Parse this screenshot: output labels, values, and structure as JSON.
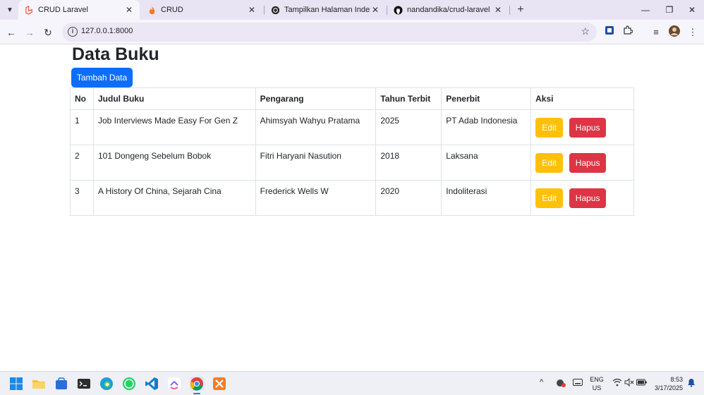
{
  "tabs": [
    {
      "title": "CRUD Laravel",
      "active": true
    },
    {
      "title": "CRUD",
      "active": false
    },
    {
      "title": "Tampilkan Halaman Index Buku",
      "active": false
    },
    {
      "title": "nandandika/crud-laravel",
      "active": false
    }
  ],
  "address_bar": {
    "url": "127.0.0.1:8000"
  },
  "page": {
    "title": "Data Buku",
    "add_button": "Tambah Data",
    "columns": [
      "No",
      "Judul Buku",
      "Pengarang",
      "Tahun Terbit",
      "Penerbit",
      "Aksi"
    ],
    "rows": [
      {
        "no": "1",
        "judul": "Job Interviews Made Easy For Gen Z",
        "pengarang": "Ahimsyah Wahyu Pratama",
        "tahun": "2025",
        "penerbit": "PT Adab Indonesia",
        "edit": "Edit",
        "hapus": "Hapus"
      },
      {
        "no": "2",
        "judul": "101 Dongeng Sebelum Bobok",
        "pengarang": "Fitri Haryani Nasution",
        "tahun": "2018",
        "penerbit": "Laksana",
        "edit": "Edit",
        "hapus": "Hapus"
      },
      {
        "no": "3",
        "judul": "A History Of China, Sejarah Cina",
        "pengarang": "Frederick Wells W",
        "tahun": "2020",
        "penerbit": "Indoliterasi",
        "edit": "Edit",
        "hapus": "Hapus"
      }
    ]
  },
  "taskbar": {
    "lang_line1": "ENG",
    "lang_line2": "US",
    "time": "8:53",
    "date": "3/17/2025"
  },
  "colors": {
    "primary": "#0d6efd",
    "warning": "#ffc107",
    "danger": "#dc3545",
    "tabstrip": "#e8e4f4"
  }
}
